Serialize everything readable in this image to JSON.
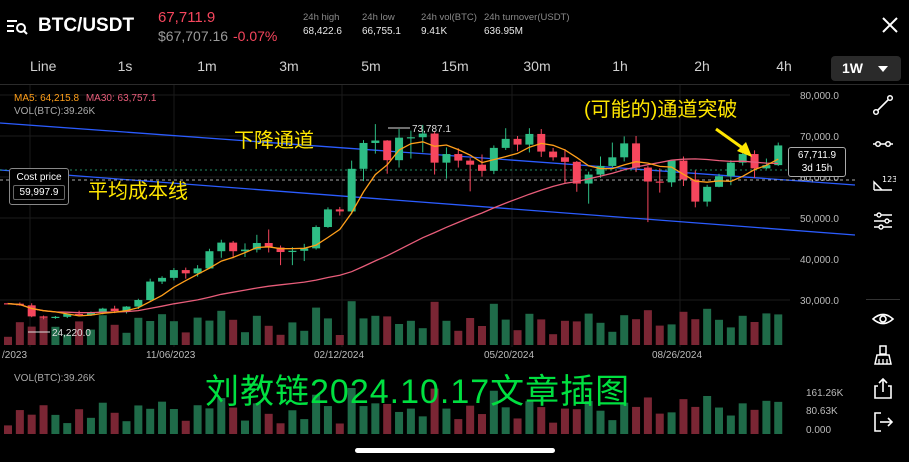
{
  "header": {
    "pair": "BTC/USDT",
    "last_price": "67,711.9",
    "usd_price": "$67,707.16",
    "change": "-0.07%",
    "stats": [
      {
        "label": "24h high",
        "value": "68,422.6"
      },
      {
        "label": "24h low",
        "value": "66,755.1"
      },
      {
        "label": "24h vol(BTC)",
        "value": "9.41K"
      },
      {
        "label": "24h turnover(USDT)",
        "value": "636.95M"
      }
    ]
  },
  "intervals": {
    "items": [
      "Line",
      "1s",
      "1m",
      "3m",
      "5m",
      "15m",
      "30m",
      "1h",
      "2h",
      "4h"
    ],
    "selected": "1W"
  },
  "main_chart": {
    "ma5_label": "MA5: 64,215.8",
    "ma30_label": "MA30: 63,757.1",
    "vol_label": "VOL(BTC):39.26K",
    "high_marker": "73,787.1",
    "low_marker": "24,220.0",
    "cost_price_label": "Cost price",
    "cost_price_value": "59,997.9",
    "current_price_box": "67,711.9",
    "countdown": "3d 15h",
    "price_axis": [
      "80,000.0",
      "70,000.0",
      "60,000.0",
      "50,000.0",
      "40,000.0",
      "30,000.0"
    ],
    "date_axis": [
      "/2023",
      "11/06/2023",
      "02/12/2024",
      "05/20/2024",
      "08/26/2024"
    ]
  },
  "volume_chart": {
    "label": "VOL(BTC):39.26K",
    "axis": [
      "161.26K",
      "80.63K",
      "0.000"
    ]
  },
  "annotations": {
    "down_channel": "下降通道",
    "avg_cost": "平均成本线",
    "breakout": "(可能的)通道突破",
    "watermark": "刘教链2024.10.17文章插图"
  },
  "colors": {
    "up": "#2ebd85",
    "down": "#f6465d",
    "ma5": "#ff9f1a",
    "ma30": "#e85d7a",
    "channel": "#2b5cff",
    "annotation": "#ffe600",
    "watermark": "#00e040",
    "background": "#000000"
  },
  "toolbar": {
    "icons": [
      "trend-line-icon",
      "horizontal-line-icon",
      "price-scale-icon",
      "indicator-settings-icon",
      "eye-icon",
      "brush-icon",
      "share-icon",
      "exit-icon"
    ]
  },
  "chart_data": {
    "type": "candlestick",
    "timeframe": "1W",
    "x_range": [
      "2023-08",
      "2024-10"
    ],
    "ylim": [
      20000,
      82000
    ],
    "candles": [
      [
        29200,
        29300,
        28900,
        29100
      ],
      [
        29100,
        29400,
        28600,
        28700
      ],
      [
        28700,
        29200,
        25800,
        26000
      ],
      [
        26000,
        26200,
        25300,
        25800
      ],
      [
        25800,
        26100,
        25400,
        25900
      ],
      [
        25900,
        26700,
        25600,
        26600
      ],
      [
        26600,
        27400,
        26000,
        26300
      ],
      [
        26300,
        27200,
        26100,
        27000
      ],
      [
        27000,
        28100,
        26500,
        27900
      ],
      [
        27900,
        28600,
        26800,
        27300
      ],
      [
        27300,
        28500,
        26700,
        28400
      ],
      [
        28400,
        30300,
        27800,
        30000
      ],
      [
        30000,
        35200,
        29800,
        34500
      ],
      [
        34500,
        35800,
        33900,
        35400
      ],
      [
        35400,
        37800,
        34800,
        37300
      ],
      [
        37300,
        37900,
        35200,
        36500
      ],
      [
        36500,
        38500,
        35700,
        37700
      ],
      [
        37700,
        42500,
        37600,
        41900
      ],
      [
        41900,
        44700,
        40300,
        44000
      ],
      [
        44000,
        44400,
        40200,
        41900
      ],
      [
        41900,
        43800,
        40500,
        42300
      ],
      [
        42300,
        45900,
        41600,
        43900
      ],
      [
        43900,
        47200,
        41600,
        42800
      ],
      [
        42800,
        43300,
        38500,
        41700
      ],
      [
        41700,
        42900,
        38500,
        42000
      ],
      [
        42000,
        43700,
        39500,
        42600
      ],
      [
        42600,
        48200,
        42300,
        47800
      ],
      [
        47800,
        52600,
        47600,
        52100
      ],
      [
        52100,
        52700,
        50600,
        51600
      ],
      [
        51600,
        64000,
        50900,
        62000
      ],
      [
        62000,
        69000,
        59000,
        68300
      ],
      [
        68300,
        72900,
        65700,
        68900
      ],
      [
        68900,
        69000,
        60800,
        64100
      ],
      [
        64100,
        71700,
        62300,
        69600
      ],
      [
        69600,
        71300,
        64500,
        69700
      ],
      [
        69700,
        72700,
        66000,
        70600
      ],
      [
        70600,
        71200,
        60600,
        63500
      ],
      [
        63500,
        67200,
        59600,
        65600
      ],
      [
        65600,
        67000,
        62300,
        64000
      ],
      [
        64000,
        64600,
        56500,
        63000
      ],
      [
        63000,
        65500,
        60100,
        61500
      ],
      [
        61500,
        67700,
        60700,
        67100
      ],
      [
        67100,
        71900,
        66600,
        69300
      ],
      [
        69300,
        70000,
        66300,
        67900
      ],
      [
        67900,
        71900,
        66000,
        70500
      ],
      [
        70500,
        71700,
        64900,
        66200
      ],
      [
        66200,
        67100,
        64000,
        64800
      ],
      [
        64800,
        66800,
        58400,
        63700
      ],
      [
        63700,
        63900,
        56400,
        58400
      ],
      [
        58400,
        61300,
        53500,
        60600
      ],
      [
        60600,
        65000,
        59800,
        62700
      ],
      [
        62700,
        68400,
        62300,
        64800
      ],
      [
        64800,
        69900,
        63800,
        68200
      ],
      [
        68200,
        70000,
        61200,
        62300
      ],
      [
        62300,
        62700,
        49000,
        58900
      ],
      [
        58900,
        62100,
        56200,
        58700
      ],
      [
        58700,
        61700,
        57600,
        64000
      ],
      [
        64000,
        65000,
        57800,
        59400
      ],
      [
        59400,
        61600,
        52600,
        54000
      ],
      [
        54000,
        58100,
        52800,
        57600
      ],
      [
        57600,
        60800,
        57500,
        60200
      ],
      [
        60200,
        64100,
        58000,
        63500
      ],
      [
        63500,
        66100,
        62800,
        65600
      ],
      [
        65600,
        66500,
        59800,
        62100
      ],
      [
        62100,
        64500,
        61900,
        62900
      ],
      [
        62900,
        68400,
        62700,
        67700
      ]
    ],
    "volume_axis": [
      0,
      80630,
      161260
    ]
  }
}
